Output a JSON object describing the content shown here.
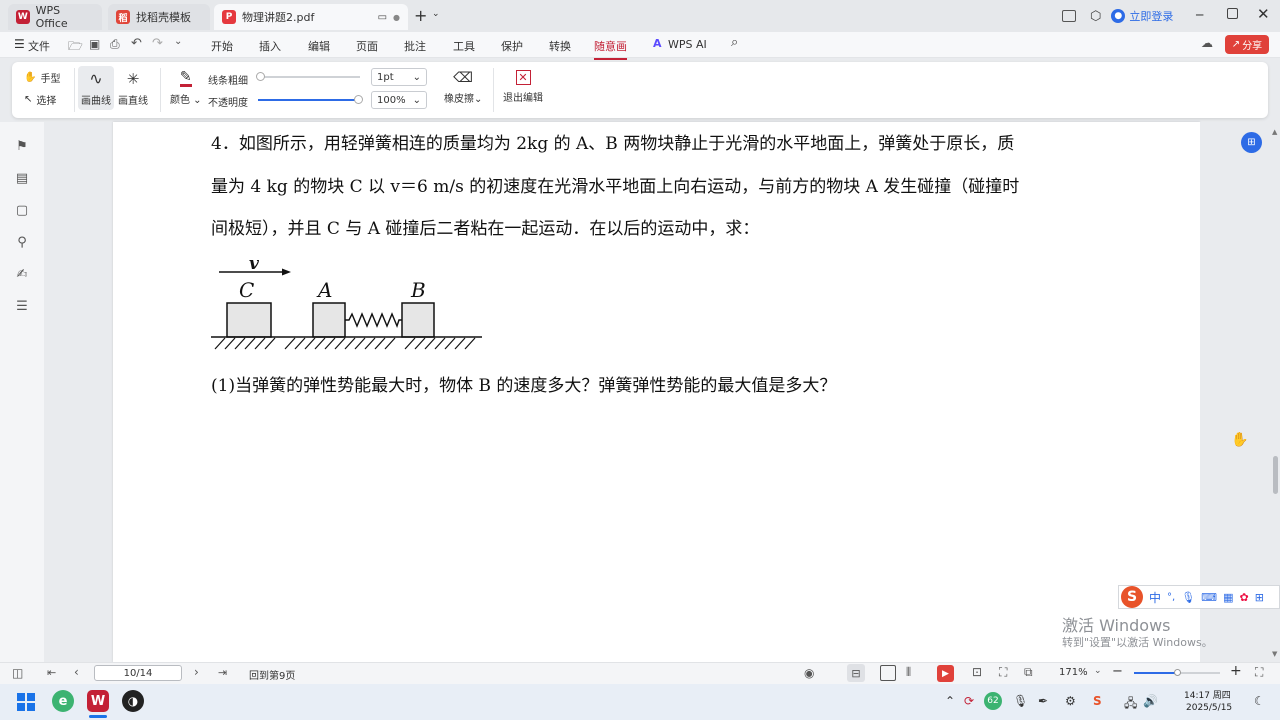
{
  "tabs": {
    "wps_home": "WPS Office",
    "template": "找稻壳模板",
    "document": "物理讲题2.pdf",
    "new_tab": "+"
  },
  "titlebar": {
    "login": "立即登录"
  },
  "menu": {
    "file": "文件",
    "items": [
      "开始",
      "插入",
      "编辑",
      "页面",
      "批注",
      "工具",
      "保护",
      "转换",
      "随意画"
    ],
    "wps_ai": "WPS AI",
    "share": "分享"
  },
  "toolbar": {
    "hand": "手型",
    "select": "选择",
    "draw_curve": "画曲线",
    "draw_line": "画直线",
    "color": "颜色",
    "line_width_label": "线条粗细",
    "opacity_label": "不透明度",
    "line_width_value": "1pt",
    "opacity_value": "100%",
    "eraser": "橡皮擦",
    "exit_edit": "退出编辑"
  },
  "document": {
    "line1": "4．如图所示，用轻弹簧相连的质量均为 2kg 的 A、B 两物块静止于光滑的水平地面上，弹簧处于原长，质",
    "line2": "量为 4 kg 的物块 C 以 v＝6 m/s 的初速度在光滑水平地面上向右运动，与前方的物块 A 发生碰撞（碰撞时",
    "line3": "间极短），并且 C 与 A 碰撞后二者粘在一起运动．在以后的运动中，求：",
    "question1": "(1)当弹簧的弹性势能最大时，物体 B 的速度多大？弹簧弹性势能的最大值是多大？",
    "figure": {
      "v_label": "v",
      "c_label": "C",
      "a_label": "A",
      "b_label": "B"
    }
  },
  "watermark": {
    "title": "激活 Windows",
    "subtitle": "转到\"设置\"以激活 Windows。"
  },
  "ime": {
    "lang": "中"
  },
  "status": {
    "page_input": "10/14",
    "back_to": "回到第9页",
    "zoom": "171%"
  },
  "taskbar": {
    "time": "14:17 周四",
    "date": "2025/5/15",
    "badge": "62"
  },
  "colors": {
    "accent": "#c32136",
    "wps_blue": "#2d6be6"
  }
}
